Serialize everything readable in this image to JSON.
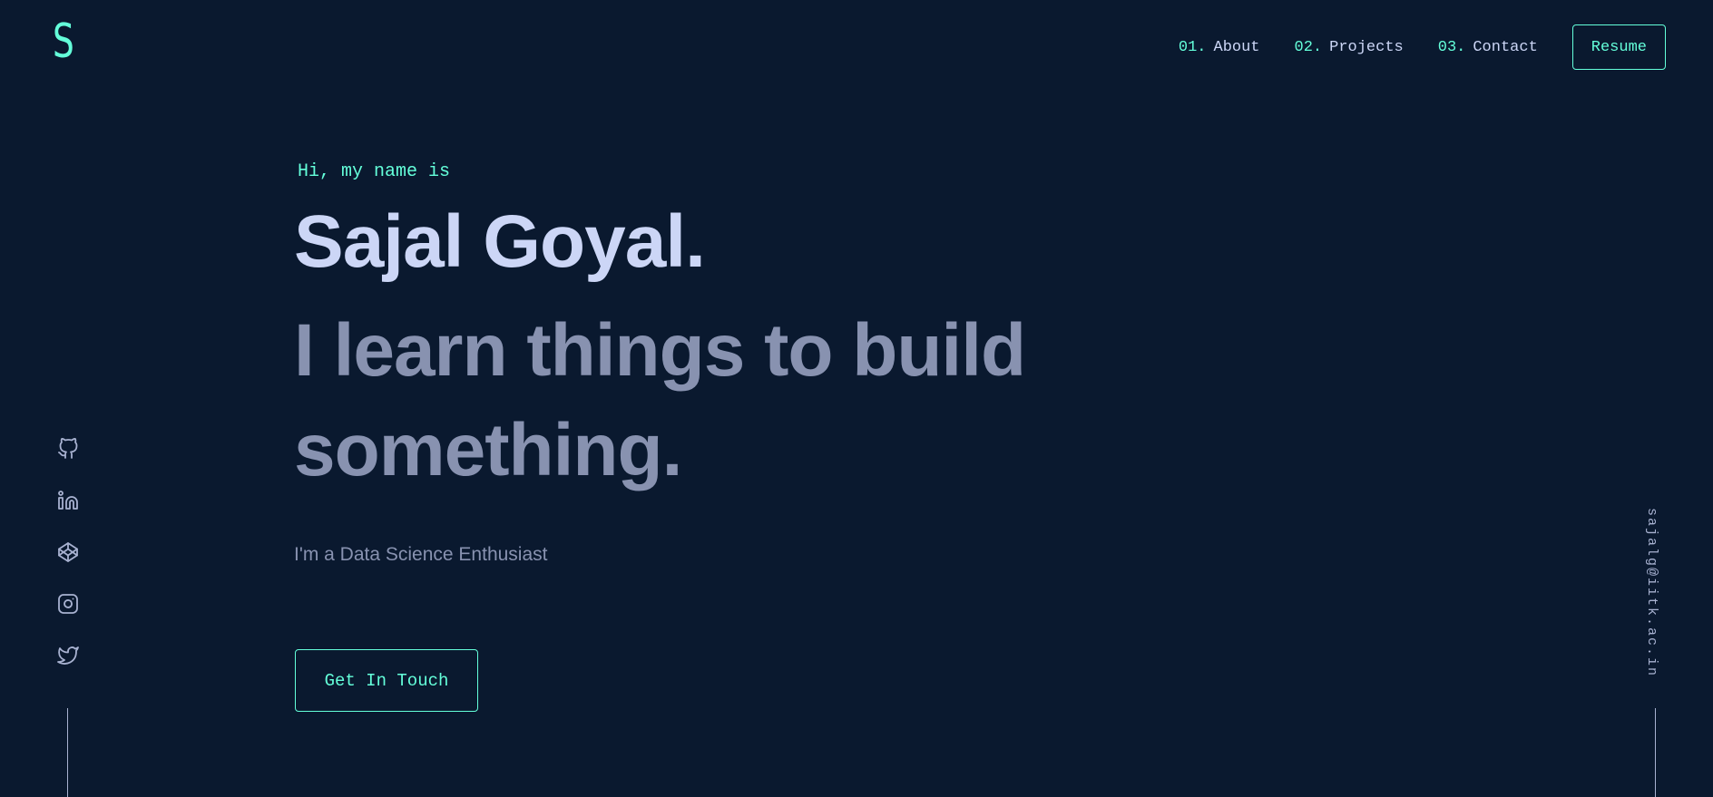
{
  "header": {
    "logo": "S",
    "nav": [
      {
        "num": "01.",
        "label": "About"
      },
      {
        "num": "02.",
        "label": "Projects"
      },
      {
        "num": "03.",
        "label": "Contact"
      }
    ],
    "resume_label": "Resume"
  },
  "hero": {
    "greeting": "Hi, my name is",
    "name": "Sajal Goyal.",
    "tagline": "I learn things to build something.",
    "subtitle": "I'm a Data Science Enthusiast",
    "cta_label": "Get In Touch"
  },
  "social": {
    "icons": [
      "github-icon",
      "linkedin-icon",
      "codepen-icon",
      "instagram-icon",
      "twitter-icon"
    ]
  },
  "email": "sajalg@iitk.ac.in",
  "colors": {
    "background": "#0a192f",
    "accent": "#64ffda",
    "heading": "#ccd6f6",
    "body": "#8892b0",
    "icon": "#a8b2d1"
  }
}
